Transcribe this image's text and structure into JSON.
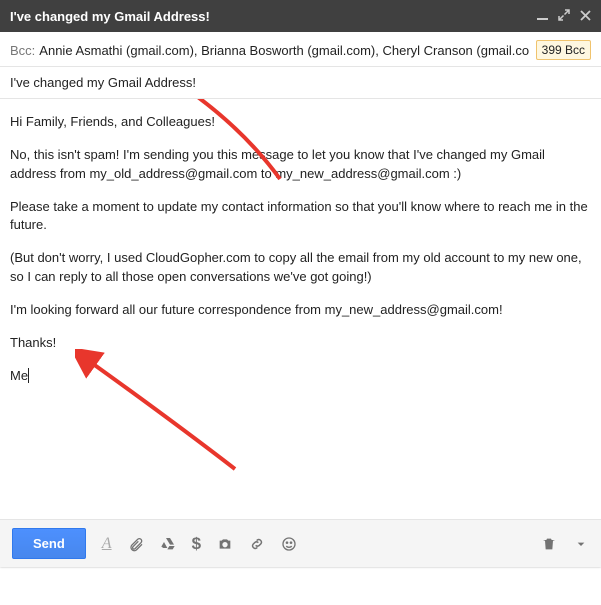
{
  "window": {
    "title": "I've changed my Gmail Address!"
  },
  "recipients": {
    "bcc_label": "Bcc:",
    "list": "Annie Asmathi (gmail.com), Brianna Bosworth (gmail.com), Cheryl Cranson (gmail.com)",
    "count_badge": "399 Bcc"
  },
  "subject": "I've changed my Gmail Address!",
  "body": {
    "greeting": "Hi Family, Friends, and Colleagues!",
    "p1": "No, this isn't spam!  I'm sending you this message to let you know that I've changed my Gmail address from my_old_address@gmail.com to my_new_address@gmail.com  :)",
    "p2": "Please take a moment to update my contact information so that you'll know where to reach me in the future.",
    "p3": "(But don't worry, I used CloudGopher.com to copy all the email from my old account to my new one, so I can reply to all those open conversations we've got going!)",
    "p4": "I'm looking forward all our future correspondence from my_new_address@gmail.com!",
    "thanks": "Thanks!",
    "signature": "Me"
  },
  "toolbar": {
    "send": "Send"
  }
}
